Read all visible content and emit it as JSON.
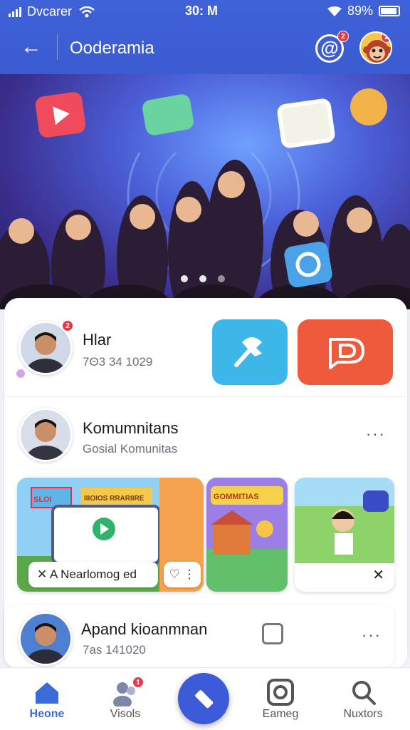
{
  "status_bar": {
    "carrier": "Dvcarer",
    "time": "30: M",
    "battery": "89%"
  },
  "header": {
    "title": "Ooderamia",
    "mention_badge": "2",
    "avatar_badge": "2"
  },
  "banner": {
    "slide_count": 3,
    "active_slide": 2
  },
  "row1": {
    "name": "Hlar",
    "detail": "7Θ3 34 1029",
    "badge": "2"
  },
  "row2": {
    "name": "Komumnitans",
    "detail": "Gosial Komunitas",
    "more": "···"
  },
  "cards": {
    "card1_label": "A Nearlomog ed",
    "card1_close": "✕",
    "card1_heart": "♡ ⋮",
    "card1_title": "IIIOIOS RRARIIRE",
    "card1_sign": "SLOI",
    "card2_title": "GOMMITIAS",
    "card3_close": "✕"
  },
  "row4": {
    "name": "Apand kioanmnan",
    "detail": "7as 141020",
    "more": "···"
  },
  "bottom_nav": {
    "items": [
      {
        "label": "Heone",
        "icon": "home-icon",
        "active": true
      },
      {
        "label": "Visols",
        "icon": "people-icon",
        "badge": "1"
      },
      {
        "label": "Eameg",
        "icon": "camera-icon"
      },
      {
        "label": "Nuxtors",
        "icon": "search-icon"
      }
    ]
  },
  "colors": {
    "primary": "#3b5bd9",
    "pin_button": "#3db6ea",
    "d_button": "#ef5a3c",
    "badge": "#e53945"
  }
}
